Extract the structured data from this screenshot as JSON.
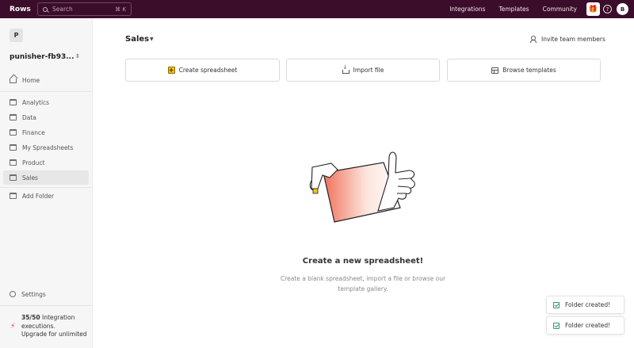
{
  "app": {
    "logo": "Rows"
  },
  "search": {
    "placeholder": "Search",
    "shortcut": "⌘ K"
  },
  "topnav": {
    "items": [
      "Integrations",
      "Templates",
      "Community"
    ]
  },
  "user": {
    "avatar_initial": "B"
  },
  "workspace": {
    "avatar_initial": "P",
    "name": "punisher-fb93..."
  },
  "sidebar": {
    "home": "Home",
    "folders": [
      "Analytics",
      "Data",
      "Finance",
      "My Spreadsheets",
      "Product",
      "Sales"
    ],
    "active_folder": "Sales",
    "add_folder": "Add Folder",
    "settings": "Settings"
  },
  "usage": {
    "count": "35/50",
    "text": "Integration executions.",
    "upgrade": "Upgrade for unlimited"
  },
  "main": {
    "title": "Sales",
    "invite_label": "Invite team members",
    "actions": [
      "Create spreadsheet",
      "Import file",
      "Browse templates"
    ],
    "empty_title": "Create a new spreadsheet!",
    "empty_desc": "Create a blank spreadsheet, import a file or browse our template gallery."
  },
  "toasts": [
    "Folder created!",
    "Folder created!"
  ],
  "colors": {
    "topbar": "#3b0d2a",
    "accent_yellow": "#f4c20d",
    "success": "#2e9b6a",
    "bolt": "#e53935"
  }
}
